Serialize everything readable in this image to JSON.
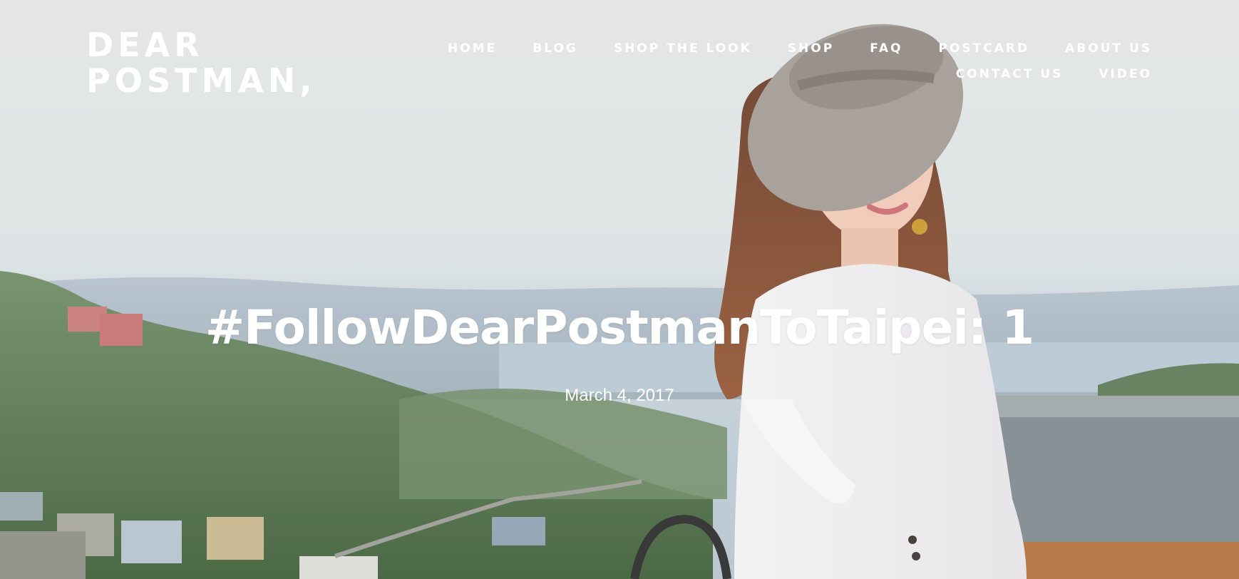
{
  "site": {
    "logo_line1": "DEAR",
    "logo_line2": "POSTMAN,"
  },
  "nav": {
    "row1": [
      "HOME",
      "BLOG",
      "SHOP THE LOOK",
      "SHOP",
      "FAQ",
      "POSTCARD",
      "ABOUT US"
    ],
    "row2": [
      "CONTACT US",
      "VIDEO"
    ]
  },
  "post": {
    "title": "#FollowDearPostmanToTaipei: 1",
    "date": "March 4, 2017"
  },
  "colors": {
    "text": "#ffffff",
    "sky": "#dde2e1",
    "hills": "#5f7c58"
  }
}
